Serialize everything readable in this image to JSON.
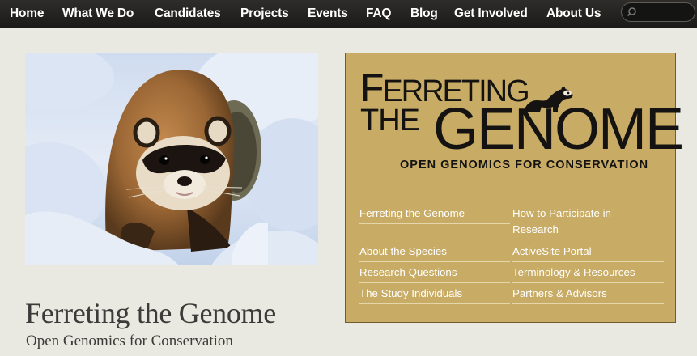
{
  "nav": {
    "items": [
      "Home",
      "What We Do",
      "Candidates",
      "Projects",
      "Events",
      "FAQ",
      "Blog",
      "Get Involved",
      "About Us"
    ],
    "search_placeholder": ""
  },
  "site": {
    "title": "Ferreting the Genome",
    "tagline": "Open Genomics for Conservation"
  },
  "logo": {
    "line1_f": "F",
    "line1_rest": "ERRETING",
    "line2": "THE",
    "line3": "GENOME",
    "tagline": "OPEN GENOMICS FOR CONSERVATION"
  },
  "feature_links": {
    "left": [
      "Ferreting the Genome",
      "About the Species",
      "Research Questions",
      "The Study Individuals"
    ],
    "right": [
      "How to Participate in Research",
      "ActiveSite Portal",
      "Terminology & Resources",
      "Partners & Advisors"
    ]
  },
  "colors": {
    "nav_bg": "#1f1e1c",
    "page_bg": "#e9e8e1",
    "feature_bg": "#c8ab64",
    "text_dark": "#3b3b39"
  }
}
